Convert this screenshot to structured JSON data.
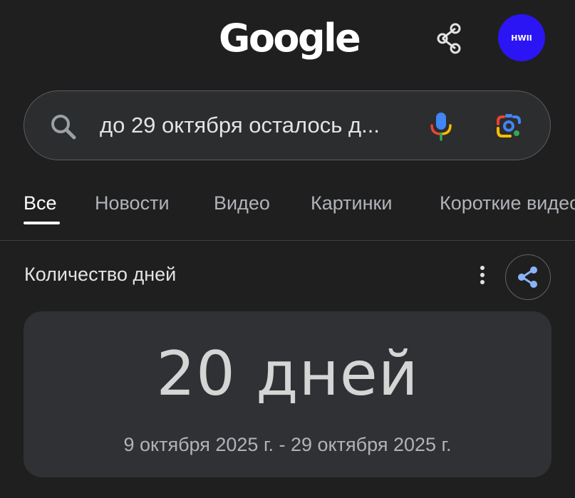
{
  "header": {
    "logo_text": "Google",
    "avatar_text": "HWII",
    "avatar_color": "#2b15f5",
    "share_icon": "share-icon"
  },
  "search": {
    "query": "до 29 октября осталось д...",
    "icons": [
      "search-icon",
      "microphone-icon",
      "google-lens-icon"
    ]
  },
  "tabs": [
    {
      "label": "Все",
      "active": true
    },
    {
      "label": "Новости",
      "active": false
    },
    {
      "label": "Видео",
      "active": false
    },
    {
      "label": "Картинки",
      "active": false
    },
    {
      "label": "Короткие видео",
      "active": false
    }
  ],
  "result": {
    "section_title": "Количество дней",
    "value": "20 дней",
    "date_range": "9 октября 2025 г. - 29 октября 2025 г.",
    "icons": [
      "more-vert-icon",
      "share-icon"
    ]
  },
  "colors": {
    "background": "#1f1f1f",
    "card": "#303134",
    "search_bar": "#2c2d2f",
    "accent_blue": "#8ab4f8"
  }
}
